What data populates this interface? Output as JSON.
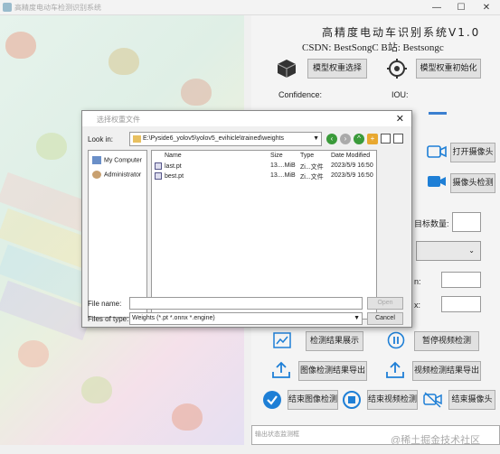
{
  "window": {
    "title": "高精度电动车检测识别系统",
    "minimize": "—",
    "maximize": "☐",
    "close": "✕"
  },
  "header": {
    "title": "高精度电动车识别系统V1.0",
    "csdn": "CSDN: BestSongC  B站: Bestsongc"
  },
  "controls": {
    "model_select": "模型权重选择",
    "model_init": "模型权重初始化",
    "confidence_label": "Confidence:",
    "iou_label": "IOU:",
    "open_camera": "打开摄像头",
    "camera_detect": "摄像头检测",
    "target_count_label": "目标数量:",
    "label_n": "n:",
    "label_x": "x:",
    "show_results": "检测结果展示",
    "pause_video": "暂停视频检测",
    "export_image": "图像检测结果导出",
    "export_video": "视频检测结果导出",
    "end_image": "结束图像检测",
    "end_video": "结束视频检测",
    "end_camera": "结束摄像头",
    "status_placeholder": "输出状态监测框"
  },
  "dialog": {
    "title": "选择权重文件",
    "look_in_label": "Look in:",
    "path": "E:\\Pyside6_yolov5\\yolov5_evihicle\\trained\\weights",
    "places": [
      "My Computer",
      "Administrator"
    ],
    "columns": [
      "Name",
      "Size",
      "Type",
      "Date Modified"
    ],
    "files": [
      {
        "name": "last.pt",
        "size": "13....MiB",
        "type": "Zi...文件",
        "date": "2023/5/9 16:50"
      },
      {
        "name": "best.pt",
        "size": "13....MiB",
        "type": "Zi...文件",
        "date": "2023/5/9 16:50"
      }
    ],
    "file_name_label": "File name:",
    "file_name_value": "",
    "files_of_type_label": "Files of type:",
    "files_of_type_value": "Weights (*.pt *.onnx *.engine)",
    "open_button": "Open",
    "cancel_button": "Cancel",
    "close": "✕"
  },
  "watermark": "@稀土掘金技术社区",
  "colors": {
    "accent": "#1e7fd6",
    "dialog_bg": "#f0f0f0",
    "folder": "#e8c060"
  }
}
